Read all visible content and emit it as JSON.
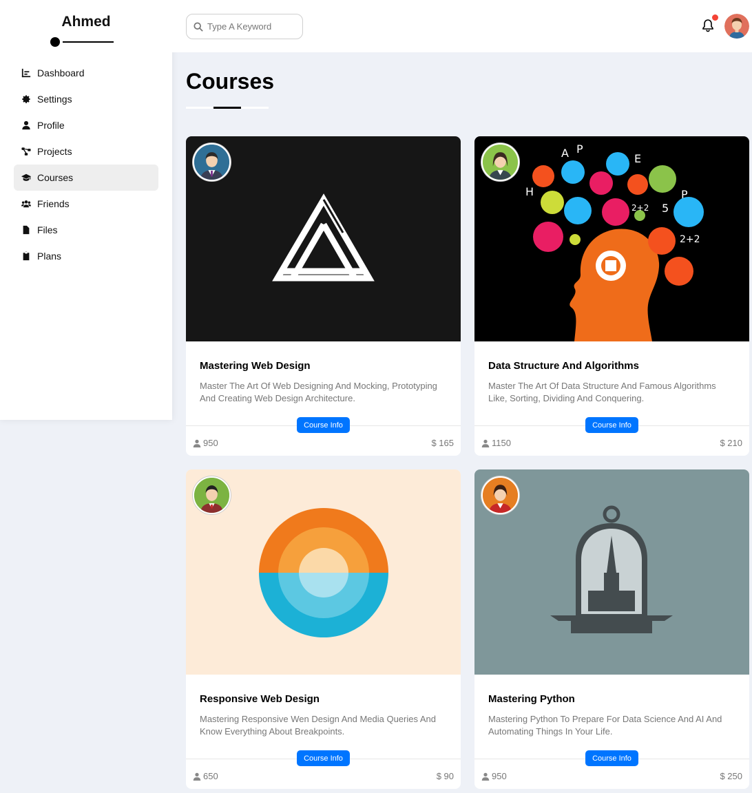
{
  "sidebar": {
    "brand": "Ahmed",
    "items": [
      {
        "label": "Dashboard",
        "icon": "chart-icon"
      },
      {
        "label": "Settings",
        "icon": "gear-icon"
      },
      {
        "label": "Profile",
        "icon": "user-icon"
      },
      {
        "label": "Projects",
        "icon": "diagram-icon"
      },
      {
        "label": "Courses",
        "icon": "graduation-cap-icon",
        "active": true
      },
      {
        "label": "Friends",
        "icon": "users-icon"
      },
      {
        "label": "Files",
        "icon": "file-icon"
      },
      {
        "label": "Plans",
        "icon": "clipboard-icon"
      }
    ]
  },
  "header": {
    "search_placeholder": "Type A Keyword"
  },
  "page": {
    "title": "Courses"
  },
  "courses": [
    {
      "title": "Mastering Web Design",
      "description": "Master The Art Of Web Designing And Mocking, Prototyping And Creating Web Design Architecture.",
      "button": "Course Info",
      "students": "950",
      "price": "$ 165"
    },
    {
      "title": "Data Structure And Algorithms",
      "description": "Master The Art Of Data Structure And Famous Algorithms Like, Sorting, Dividing And Conquering.",
      "button": "Course Info",
      "students": "1150",
      "price": "$ 210"
    },
    {
      "title": "Responsive Web Design",
      "description": "Mastering Responsive Wen Design And Media Queries And Know Everything About Breakpoints.",
      "button": "Course Info",
      "students": "650",
      "price": "$ 90"
    },
    {
      "title": "Mastering Python",
      "description": "Mastering Python To Prepare For Data Science And AI And Automating Things In Your Life.",
      "button": "Course Info",
      "students": "950",
      "price": "$ 250"
    }
  ],
  "colors": {
    "accent": "#0075ff",
    "background": "#eef1f7",
    "notification": "#f44336"
  }
}
